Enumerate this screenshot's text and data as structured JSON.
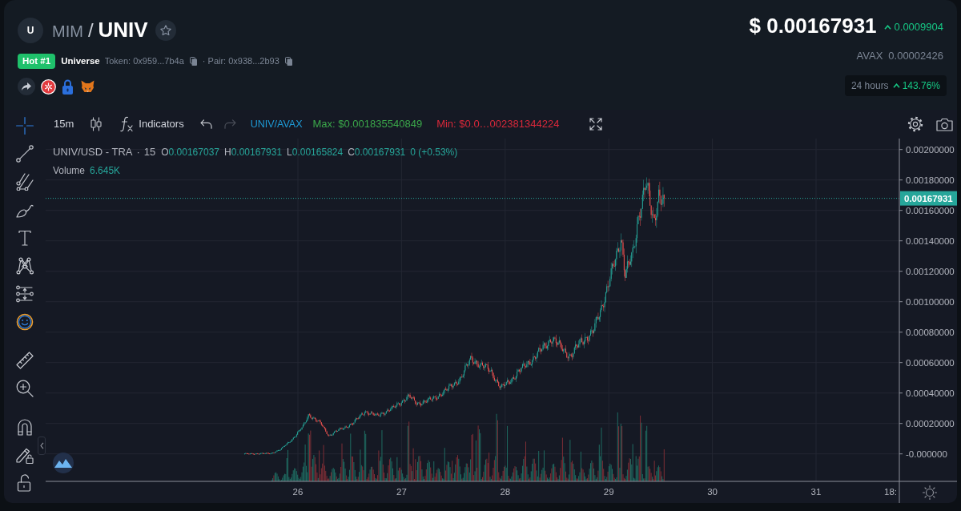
{
  "header": {
    "avatar": "U",
    "quote_symbol": "MIM",
    "separator": "/",
    "base_symbol": "UNIV",
    "starred": false
  },
  "info": {
    "rank_badge": "Hot #1",
    "token_name": "Universe",
    "token_address": "Token: 0x959...7b4a",
    "pair_address": "· Pair: 0x938...2b93"
  },
  "price": {
    "usd": "$ 0.00167931",
    "change": "0.0009904",
    "rising": true,
    "native_symbol": "AVAX",
    "native_price": "0.00002426"
  },
  "period": {
    "label": "24 hours",
    "change": "143.76%",
    "rising": true
  },
  "toolbar": {
    "interval": "15m",
    "indicators": "Indicators",
    "undo_disabled": false,
    "redo_disabled": true,
    "pair": "UNIV/AVAX",
    "max": "Max: $0.001835540849",
    "min": "Min: $0.0…002381344224"
  },
  "drawing_tools": [
    {
      "kind": "crosshair",
      "selected": true
    },
    {
      "kind": "trend_line",
      "selected": false
    },
    {
      "kind": "pitchfork",
      "selected": false
    },
    {
      "kind": "brush",
      "selected": false
    },
    {
      "kind": "text",
      "selected": false
    },
    {
      "kind": "pattern",
      "selected": false
    },
    {
      "kind": "measure",
      "selected": false
    },
    {
      "kind": "emoji",
      "selected": false
    },
    {
      "kind": "ruler",
      "selected": false
    },
    {
      "kind": "zoom",
      "selected": false
    },
    {
      "kind": "magnet",
      "selected": false
    },
    {
      "kind": "lock_drawings",
      "selected": false
    },
    {
      "kind": "lock",
      "selected": false
    }
  ],
  "legend": {
    "symbol": "UNIV/USD - TRA",
    "separator": "·",
    "interval": "15",
    "ohlc": [
      {
        "label": "O",
        "value": "0.00167037"
      },
      {
        "label": "H",
        "value": "0.00167931"
      },
      {
        "label": "L",
        "value": "0.00165824"
      },
      {
        "label": "C",
        "value": "0.00167931"
      }
    ],
    "change": "0 (+0.53%)",
    "volume_label": "Volume",
    "volume_value": "6.645K"
  },
  "price_axis": {
    "labels": [
      "0.00200000",
      "0.00180000",
      "0.00160000",
      "0.00140000",
      "0.00120000",
      "0.00100000",
      "0.00080000",
      "0.00060000",
      "0.00040000",
      "0.00020000",
      "-0.000000"
    ],
    "current_price": "0.00167931"
  },
  "time_axis": {
    "labels": [
      "26",
      "27",
      "28",
      "29",
      "30",
      "31",
      "18:"
    ]
  }
}
